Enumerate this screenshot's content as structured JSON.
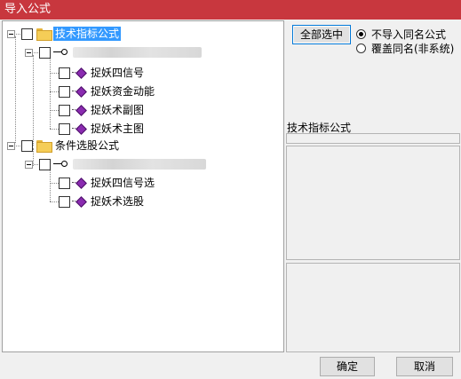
{
  "window": {
    "title": "导入公式"
  },
  "tree": {
    "root1": {
      "label": "技术指标公式",
      "child_label": "",
      "items": [
        "捉妖四信号",
        "捉妖资金动能",
        "捉妖术副图",
        "捉妖术主图"
      ]
    },
    "root2": {
      "label": "条件选股公式",
      "child_label": "",
      "items": [
        "捉妖四信号选",
        "捉妖术选股"
      ]
    }
  },
  "side": {
    "select_all": "全部选中",
    "option1": "不导入同名公式",
    "option2": "覆盖同名(非系统)",
    "selected_option": "option1",
    "info_label": "技术指标公式"
  },
  "footer": {
    "ok": "确定",
    "cancel": "取消"
  },
  "colors": {
    "title_bg": "#c8373e",
    "selection": "#3399ff",
    "folder": "#f5cd57",
    "formula_icon": "#8a2bb0"
  }
}
